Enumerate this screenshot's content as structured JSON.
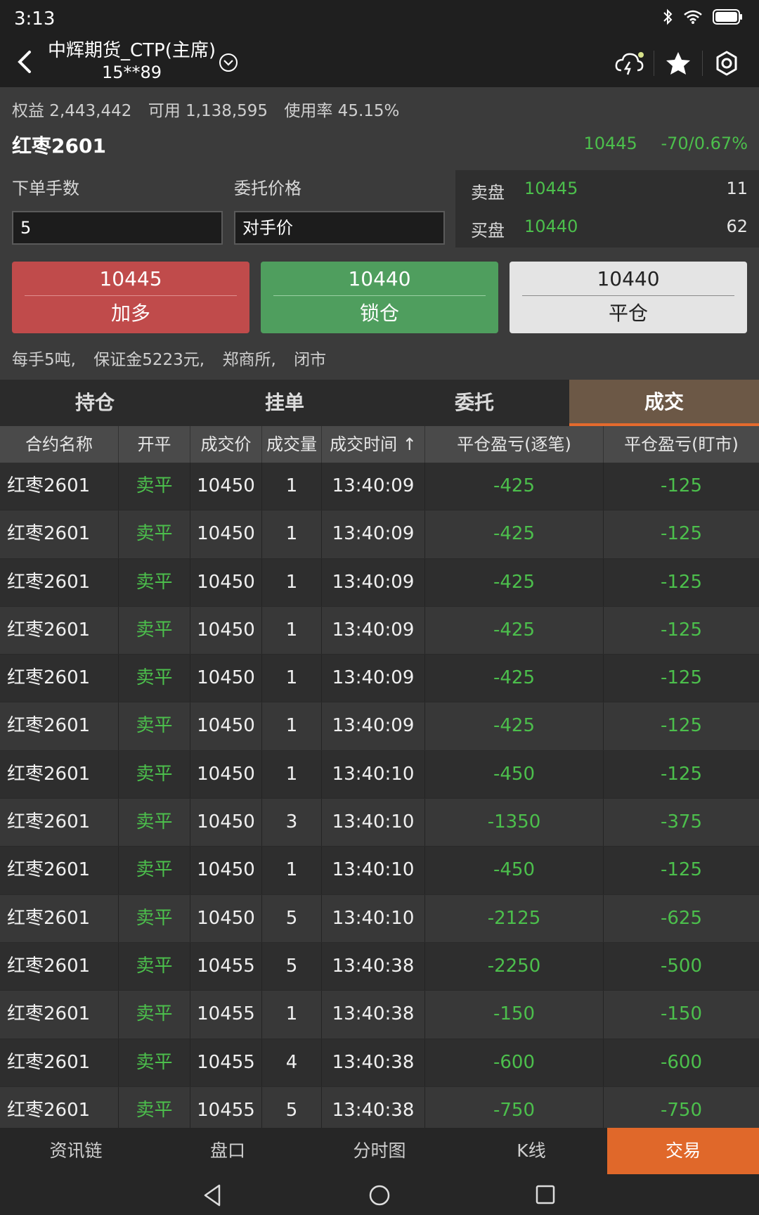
{
  "status": {
    "time": "3:13",
    "icons": [
      "bluetooth-icon",
      "wifi-icon",
      "battery-icon"
    ]
  },
  "header": {
    "account_line1": "中辉期货_CTP(主席)",
    "account_line2": "15**89",
    "icons": [
      "back-icon",
      "chevron-down-icon",
      "cloud-lightning-icon",
      "star-icon",
      "settings-icon"
    ]
  },
  "account": {
    "equity": "权益 2,443,442",
    "available": "可用 1,138,595",
    "usage": "使用率 45.15%"
  },
  "instrument": {
    "name": "红枣2601",
    "last_price": "10445",
    "change": "-70/0.67%"
  },
  "order_form": {
    "qty_label": "下单手数",
    "qty_value": "5",
    "price_label": "委托价格",
    "price_value": "对手价"
  },
  "book": {
    "ask_label": "卖盘",
    "ask_price": "10445",
    "ask_vol": "11",
    "bid_label": "买盘",
    "bid_price": "10440",
    "bid_vol": "62"
  },
  "buttons": {
    "buy": {
      "price": "10445",
      "label": "加多"
    },
    "lock": {
      "price": "10440",
      "label": "锁仓"
    },
    "close": {
      "price": "10440",
      "label": "平仓"
    }
  },
  "info": {
    "lot": "每手5吨,",
    "margin": "保证金5223元,",
    "exchange": "郑商所,",
    "state": "闭市"
  },
  "tabs": [
    "持仓",
    "挂单",
    "委托",
    "成交"
  ],
  "table": {
    "headers": [
      "合约名称",
      "开平",
      "成交价",
      "成交量",
      "成交时间 ↑",
      "平仓盈亏(逐笔)",
      "平仓盈亏(盯市)"
    ],
    "rows": [
      [
        "红枣2601",
        "卖平",
        "10450",
        "1",
        "13:40:09",
        "-425",
        "-125"
      ],
      [
        "红枣2601",
        "卖平",
        "10450",
        "1",
        "13:40:09",
        "-425",
        "-125"
      ],
      [
        "红枣2601",
        "卖平",
        "10450",
        "1",
        "13:40:09",
        "-425",
        "-125"
      ],
      [
        "红枣2601",
        "卖平",
        "10450",
        "1",
        "13:40:09",
        "-425",
        "-125"
      ],
      [
        "红枣2601",
        "卖平",
        "10450",
        "1",
        "13:40:09",
        "-425",
        "-125"
      ],
      [
        "红枣2601",
        "卖平",
        "10450",
        "1",
        "13:40:09",
        "-425",
        "-125"
      ],
      [
        "红枣2601",
        "卖平",
        "10450",
        "1",
        "13:40:10",
        "-450",
        "-125"
      ],
      [
        "红枣2601",
        "卖平",
        "10450",
        "3",
        "13:40:10",
        "-1350",
        "-375"
      ],
      [
        "红枣2601",
        "卖平",
        "10450",
        "1",
        "13:40:10",
        "-450",
        "-125"
      ],
      [
        "红枣2601",
        "卖平",
        "10450",
        "5",
        "13:40:10",
        "-2125",
        "-625"
      ],
      [
        "红枣2601",
        "卖平",
        "10455",
        "5",
        "13:40:38",
        "-2250",
        "-500"
      ],
      [
        "红枣2601",
        "卖平",
        "10455",
        "1",
        "13:40:38",
        "-150",
        "-150"
      ],
      [
        "红枣2601",
        "卖平",
        "10455",
        "4",
        "13:40:38",
        "-600",
        "-600"
      ],
      [
        "红枣2601",
        "卖平",
        "10455",
        "5",
        "13:40:38",
        "-750",
        "-750"
      ]
    ]
  },
  "bottom_nav": [
    "资讯链",
    "盘口",
    "分时图",
    "K线",
    "交易"
  ],
  "colors": {
    "up": "#c04b4b",
    "down": "#4cbf4c",
    "accent": "#e0682a"
  }
}
